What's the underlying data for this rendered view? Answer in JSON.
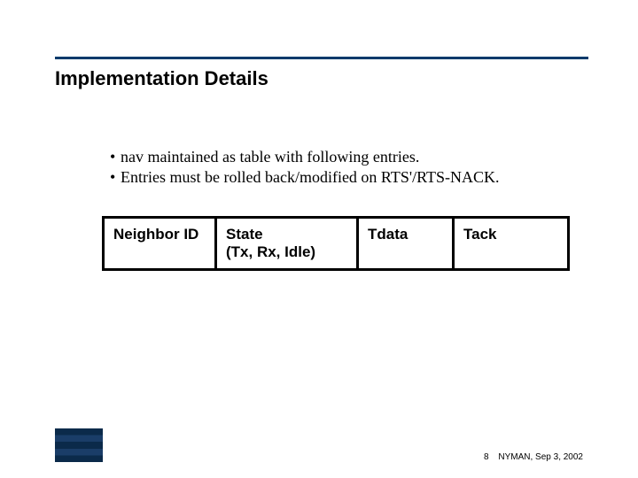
{
  "title": "Implementation Details",
  "bullets": [
    "nav maintained as table with following entries.",
    "Entries must be rolled back/modified on RTS'/RTS-NACK."
  ],
  "table": {
    "headers": {
      "col1": "Neighbor ID",
      "col2_line1": "State",
      "col2_line2": "(Tx, Rx, Idle)",
      "col3": "Tdata",
      "col4": "Tack"
    }
  },
  "footer": {
    "page": "8",
    "text": "NYMAN, Sep 3, 2002"
  }
}
